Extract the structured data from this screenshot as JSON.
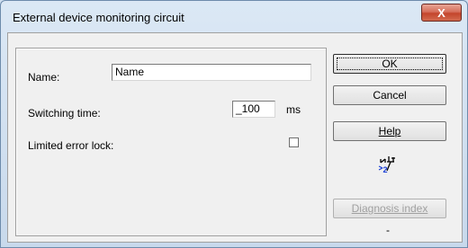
{
  "window": {
    "title": "External device monitoring circuit",
    "close_label": "X"
  },
  "form": {
    "name_label": "Name:",
    "name_value": "Name",
    "switching_label": "Switching time:",
    "switching_value": "_100",
    "switching_unit": "ms",
    "error_lock_label": "Limited error lock:",
    "error_lock_checked": false
  },
  "buttons": {
    "ok": "OK",
    "cancel": "Cancel",
    "help": "Help",
    "diagnosis": "Diagnosis index"
  },
  "icons": {
    "device": "switch-circuit-icon",
    "device_badge": "2"
  },
  "status": {
    "dash": "-"
  }
}
